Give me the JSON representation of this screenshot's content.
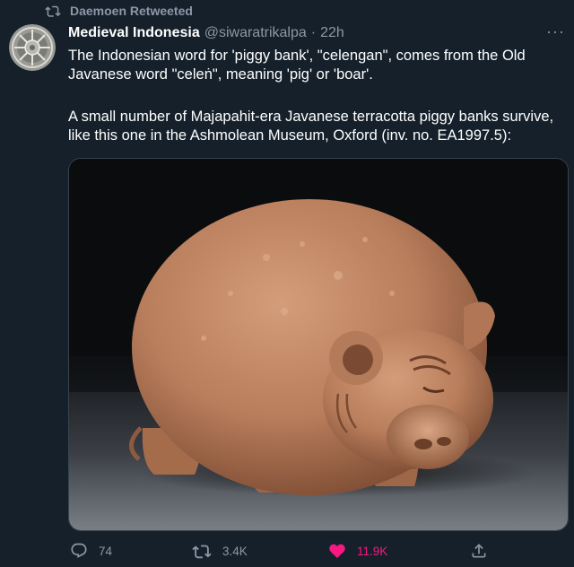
{
  "retweet_context": {
    "icon": "retweet-icon",
    "text": "Daemoen Retweeted"
  },
  "author": {
    "display_name": "Medieval Indonesia",
    "handle": "@siwaratrikalpa",
    "separator": "·",
    "time": "22h",
    "avatar": "medieval-ornament-avatar"
  },
  "more_label": "···",
  "tweet": {
    "paragraph_1": "The Indonesian word for 'piggy bank', \"celengan\", comes from the Old Javanese word \"celeṅ\", meaning 'pig' or 'boar'.",
    "paragraph_2": "A small number of Majapahit-era Javanese terracotta piggy banks survive, like this one in the Ashmolean Museum, Oxford (inv. no. EA1997.5):"
  },
  "media": {
    "subject": "terracotta-piggy-bank-photo"
  },
  "actions": {
    "reply": {
      "icon": "reply-icon",
      "count": "74"
    },
    "retweet": {
      "icon": "retweet-icon",
      "count": "3.4K"
    },
    "like": {
      "icon": "heart-filled-icon",
      "count": "11.9K",
      "color": "#f91880"
    },
    "share": {
      "icon": "share-icon"
    }
  },
  "colors": {
    "background": "#15202b",
    "secondary_text": "#8b98a5",
    "like_pink": "#f91880"
  }
}
